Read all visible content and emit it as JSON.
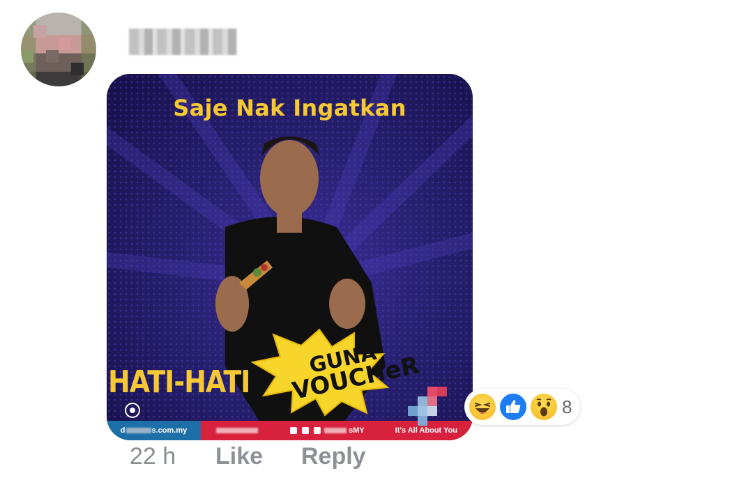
{
  "comment": {
    "author_name": "",
    "timestamp": "22 h",
    "actions": {
      "like_label": "Like",
      "reply_label": "Reply"
    }
  },
  "post_image": {
    "headline": "Saje Nak Ingatkan",
    "left_text": "HATI-HATI",
    "burst_line1": "GUNA",
    "burst_line2": "VOUCHeR",
    "footer": {
      "site": "s.com.my",
      "social_handle": "sMY",
      "tagline": "It's All About You"
    }
  },
  "reactions": {
    "icons": [
      "haha-icon",
      "like-icon",
      "wow-icon"
    ],
    "count": "8"
  },
  "colors": {
    "accent_yellow": "#f6c934",
    "like_blue": "#1d7cf2",
    "meta_gray": "#8a8d91",
    "footer_red": "#d8213c",
    "footer_blue": "#1d6fa8"
  }
}
